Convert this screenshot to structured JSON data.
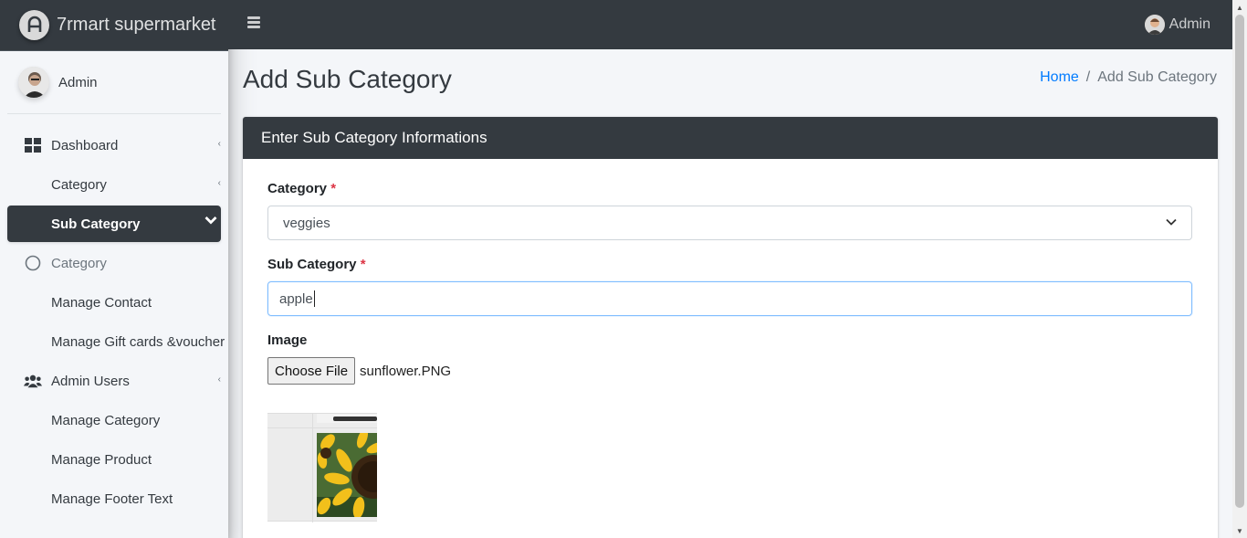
{
  "brand": {
    "name": "7rmart supermarket",
    "logo_icon": "adminlte-logo-icon"
  },
  "sidebar": {
    "user": "Admin",
    "items": [
      {
        "label": "Dashboard",
        "icon": "dashboard-grid-icon",
        "caret": "‹"
      },
      {
        "label": "Category",
        "caret": "‹"
      },
      {
        "label": "Sub Category",
        "active": true,
        "caret": "chevron-down"
      },
      {
        "label": "Category",
        "icon": "circle-icon"
      },
      {
        "label": "Manage Contact"
      },
      {
        "label": "Manage Gift cards &voucher"
      },
      {
        "label": "Admin Users",
        "icon": "users-icon",
        "caret": "‹"
      },
      {
        "label": "Manage Category"
      },
      {
        "label": "Manage Product"
      },
      {
        "label": "Manage Footer Text"
      }
    ]
  },
  "topbar": {
    "user": "Admin",
    "menu_icon": "hamburger-icon"
  },
  "page": {
    "title": "Add Sub Category"
  },
  "breadcrumb": {
    "home": "Home",
    "separator": "/",
    "current": "Add Sub Category"
  },
  "card": {
    "header": "Enter Sub Category Informations"
  },
  "form": {
    "category_label": "Category",
    "category_value": "veggies",
    "subcategory_label": "Sub Category",
    "subcategory_value": "apple",
    "required_mark": "*",
    "image_label": "Image",
    "file_button": "Choose File",
    "file_name": "sunflower.PNG"
  },
  "colors": {
    "dark": "#343a40",
    "link": "#007bff",
    "required": "#dc3545",
    "focus_border": "#80bdff"
  }
}
